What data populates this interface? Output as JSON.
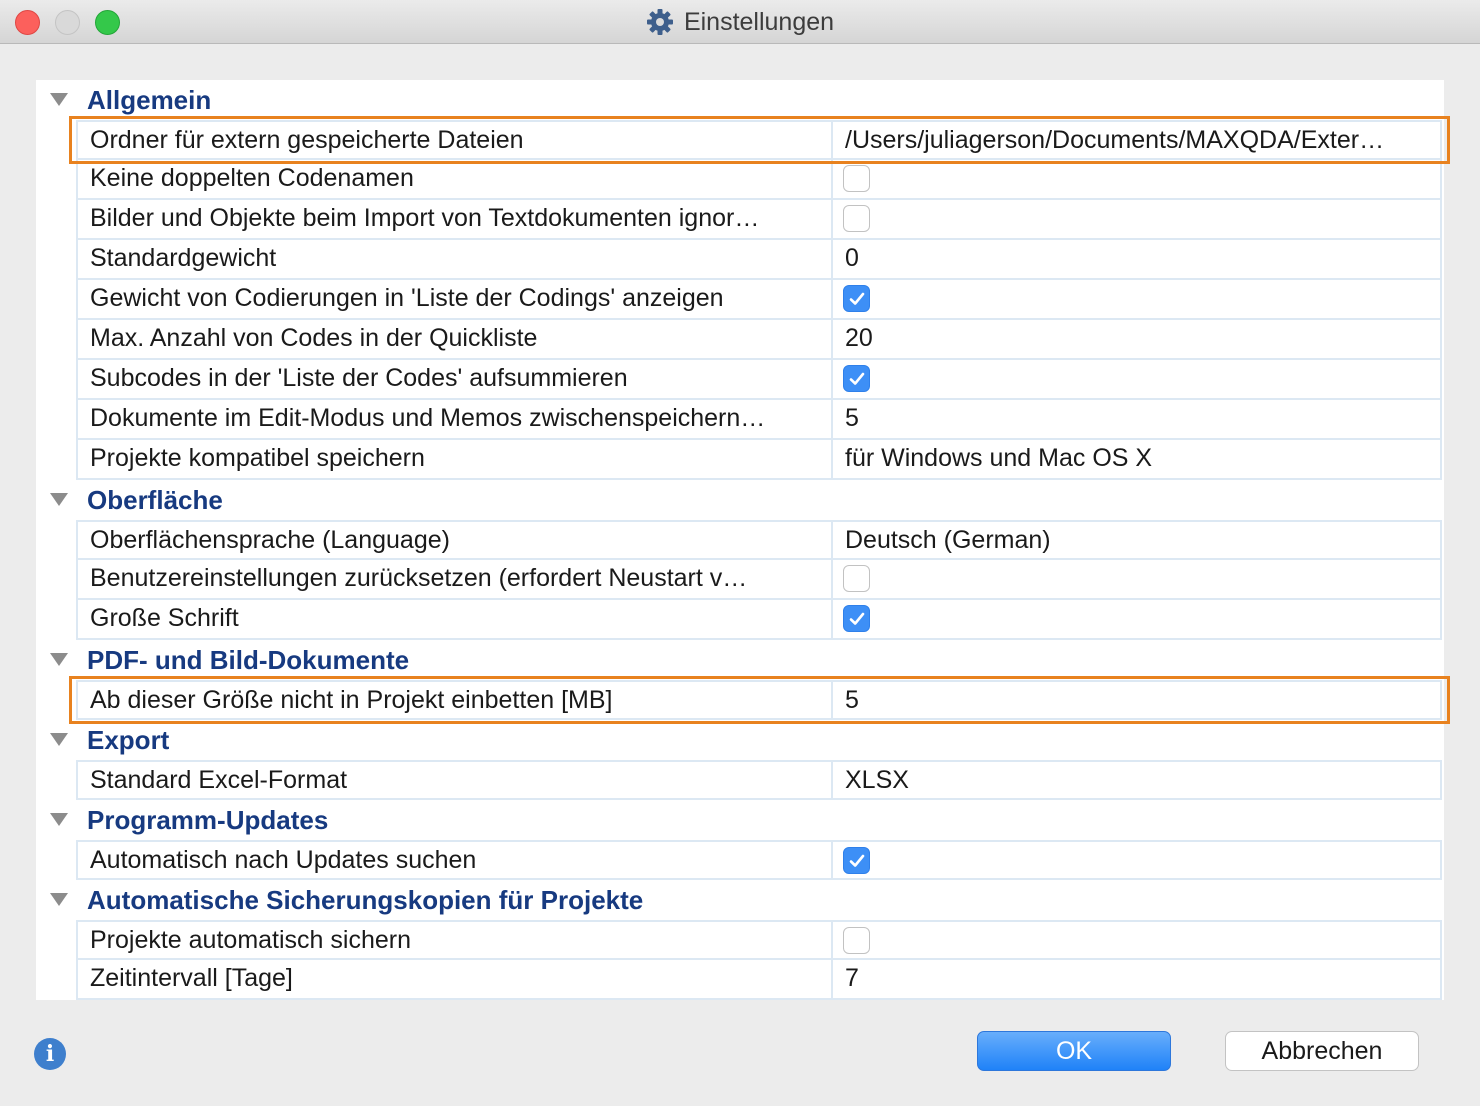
{
  "window": {
    "title": "Einstellungen"
  },
  "sections": [
    {
      "title": "Allgemein",
      "items": [
        {
          "label": "Ordner für extern gespeicherte Dateien",
          "value": "/Users/juliagerson/Documents/MAXQDA/Exter…",
          "type": "text",
          "highlighted": true
        },
        {
          "label": "Keine doppelten Codenamen",
          "type": "checkbox",
          "checked": false
        },
        {
          "label": "Bilder und Objekte beim Import von Textdokumenten ignor…",
          "type": "checkbox",
          "checked": false
        },
        {
          "label": "Standardgewicht",
          "value": "0",
          "type": "text"
        },
        {
          "label": "Gewicht von Codierungen in 'Liste der Codings' anzeigen",
          "type": "checkbox",
          "checked": true
        },
        {
          "label": "Max. Anzahl von Codes in der Quickliste",
          "value": "20",
          "type": "text"
        },
        {
          "label": "Subcodes in der 'Liste der Codes' aufsummieren",
          "type": "checkbox",
          "checked": true
        },
        {
          "label": "Dokumente im Edit-Modus und Memos zwischenspeichern…",
          "value": "5",
          "type": "text"
        },
        {
          "label": "Projekte kompatibel speichern",
          "value": "für Windows und Mac OS X",
          "type": "text"
        }
      ]
    },
    {
      "title": "Oberfläche",
      "items": [
        {
          "label": "Oberflächensprache (Language)",
          "value": "Deutsch (German)",
          "type": "text"
        },
        {
          "label": "Benutzereinstellungen zurücksetzen (erfordert Neustart v…",
          "type": "checkbox",
          "checked": false
        },
        {
          "label": "Große Schrift",
          "type": "checkbox",
          "checked": true
        }
      ]
    },
    {
      "title": "PDF- und Bild-Dokumente",
      "items": [
        {
          "label": "Ab dieser Größe nicht in Projekt einbetten [MB]",
          "value": "5",
          "type": "text",
          "highlighted": true
        }
      ]
    },
    {
      "title": "Export",
      "items": [
        {
          "label": "Standard Excel-Format",
          "value": "XLSX",
          "type": "text"
        }
      ]
    },
    {
      "title": "Programm-Updates",
      "items": [
        {
          "label": "Automatisch nach Updates suchen",
          "type": "checkbox",
          "checked": true
        }
      ]
    },
    {
      "title": "Automatische Sicherungskopien für Projekte",
      "items": [
        {
          "label": "Projekte automatisch sichern",
          "type": "checkbox",
          "checked": false
        },
        {
          "label": "Zeitintervall [Tage]",
          "value": "7",
          "type": "text"
        }
      ]
    }
  ],
  "buttons": {
    "ok": "OK",
    "cancel": "Abbrechen"
  },
  "icons": {
    "title": "gear-icon",
    "info": "info-icon",
    "disclosure": "disclosure-triangle-icon"
  },
  "colors": {
    "section_title": "#173a80",
    "highlight": "#e8821f",
    "checkbox_checked": "#3d8ff6",
    "ok_button": "#1f82f8"
  }
}
